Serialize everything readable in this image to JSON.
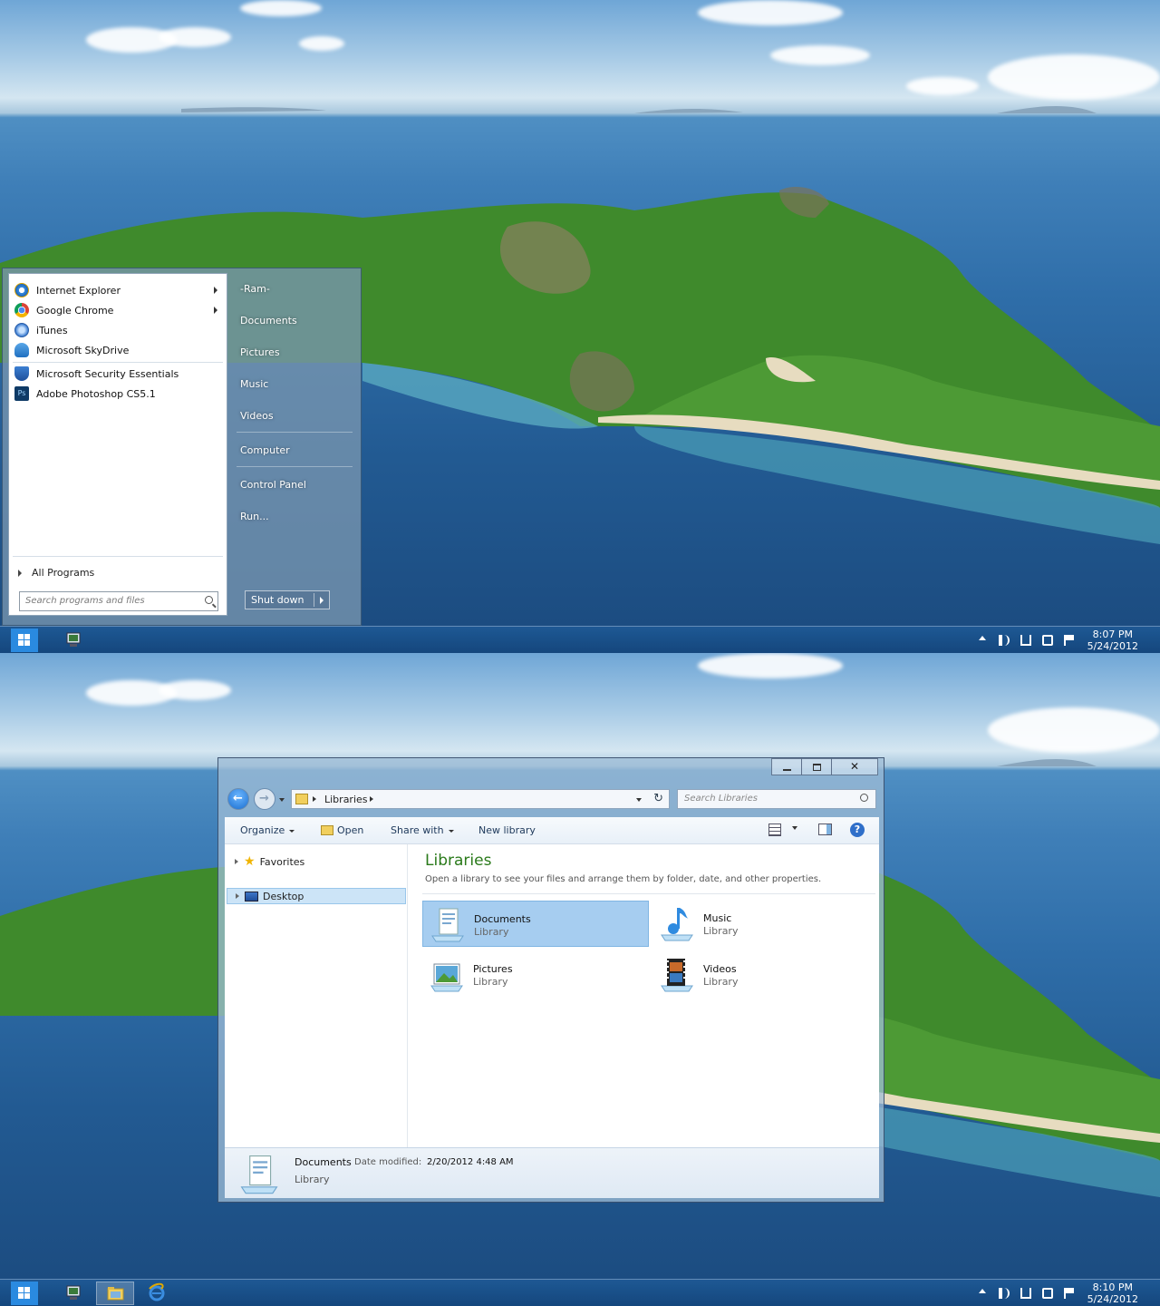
{
  "top_screen": {
    "start_menu": {
      "pinned": [
        {
          "label": "Internet Explorer",
          "icon": "internet-explorer-icon",
          "has_submenu": true
        },
        {
          "label": "Google Chrome",
          "icon": "chrome-icon",
          "has_submenu": true
        },
        {
          "label": "iTunes",
          "icon": "itunes-icon",
          "has_submenu": false
        },
        {
          "label": "Microsoft SkyDrive",
          "icon": "skydrive-icon",
          "has_submenu": false
        }
      ],
      "recent": [
        {
          "label": "Microsoft Security Essentials",
          "icon": "security-essentials-icon"
        },
        {
          "label": "Adobe Photoshop CS5.1",
          "icon": "photoshop-icon"
        }
      ],
      "all_programs": "All Programs",
      "search_placeholder": "Search programs and files",
      "right_items": [
        "-Ram-",
        "Documents",
        "Pictures",
        "Music",
        "Videos",
        "Computer",
        "Control Panel",
        "Run..."
      ],
      "shutdown_label": "Shut down"
    },
    "clock": {
      "time": "8:07 PM",
      "date": "5/24/2012"
    }
  },
  "bottom_screen": {
    "explorer": {
      "breadcrumb": "Libraries",
      "search_placeholder": "Search Libraries",
      "toolbar": {
        "organize": "Organize",
        "open": "Open",
        "share_with": "Share with",
        "new_library": "New library"
      },
      "nav": {
        "favorites": "Favorites",
        "desktop": "Desktop"
      },
      "heading": "Libraries",
      "subheading": "Open a library to see your files and arrange them by folder, date, and other properties.",
      "libraries": [
        {
          "name": "Documents",
          "kind": "Library",
          "icon": "documents-library-icon",
          "selected": true
        },
        {
          "name": "Music",
          "kind": "Library",
          "icon": "music-library-icon",
          "selected": false
        },
        {
          "name": "Pictures",
          "kind": "Library",
          "icon": "pictures-library-icon",
          "selected": false
        },
        {
          "name": "Videos",
          "kind": "Library",
          "icon": "videos-library-icon",
          "selected": false
        }
      ],
      "details": {
        "name": "Documents",
        "date_label": "Date modified:",
        "date_value": "2/20/2012 4:48 AM",
        "kind": "Library"
      }
    },
    "clock": {
      "time": "8:10 PM",
      "date": "5/24/2012"
    }
  },
  "colors": {
    "taskbar": "#1a5c99",
    "start_button": "#2a8ae0",
    "accent_green": "#2a7a1a",
    "selection": "#a6cdf0"
  }
}
